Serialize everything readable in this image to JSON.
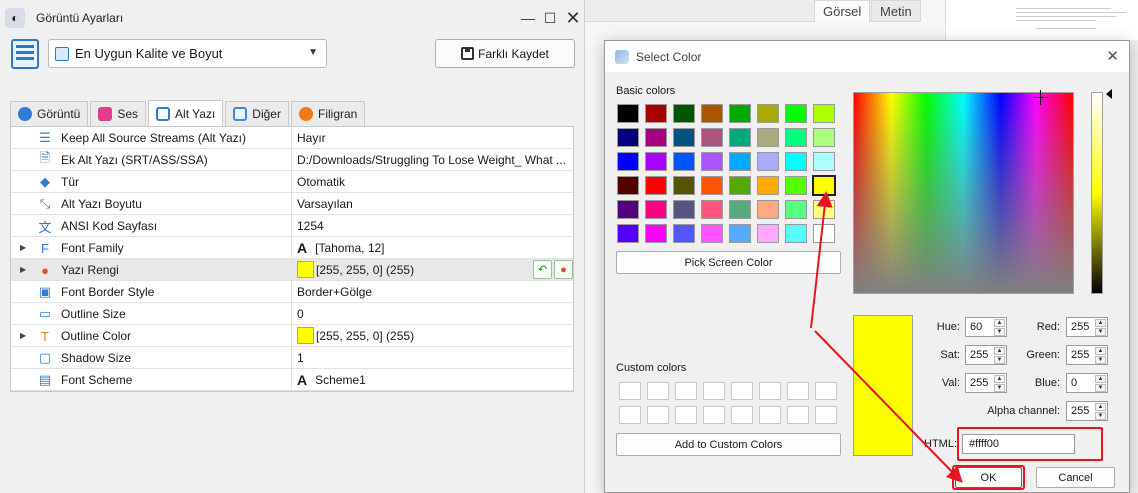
{
  "background": {
    "tabs": [
      "Görsel",
      "Metin"
    ],
    "fragments": [
      "ek",
      "la"
    ]
  },
  "main_window": {
    "title": "Görüntü Ayarları",
    "preset": "En Uygun Kalite ve Boyut",
    "save_as": "Farklı Kaydet",
    "tabs": [
      {
        "label": "Görüntü",
        "icon": "monitor-icon",
        "color": "#2f7cd3"
      },
      {
        "label": "Ses",
        "icon": "music-icon",
        "color": "#e23d8c"
      },
      {
        "label": "Alt Yazı",
        "icon": "subtitle-icon",
        "color": "#2f7cd3"
      },
      {
        "label": "Diğer",
        "icon": "sliders-icon",
        "color": "#3a8bd8"
      },
      {
        "label": "Filigran",
        "icon": "watermark-icon",
        "color": "#f07a1a"
      }
    ],
    "properties": [
      {
        "name": "Keep All Source Streams (Alt Yazı)",
        "value": "Hayır",
        "icon": "streams-icon",
        "glyph": "☰",
        "expandable": false
      },
      {
        "name": "Ek Alt Yazı (SRT/ASS/SSA)",
        "value": "D:/Downloads/Struggling To Lose Weight_ What ...",
        "icon": "file-icon",
        "glyph": "🗎",
        "expandable": false
      },
      {
        "name": "Tür",
        "value": "Otomatik",
        "icon": "cube-icon",
        "glyph": "◆",
        "expandable": false
      },
      {
        "name": "Alt Yazı Boyutu",
        "value": "Varsayılan",
        "icon": "resize-icon",
        "glyph": "⤡",
        "expandable": false
      },
      {
        "name": "ANSI Kod Sayfası",
        "value": "1254",
        "icon": "translate-icon",
        "glyph": "文",
        "expandable": false
      },
      {
        "name": "Font Family",
        "value": "[Tahoma, 12]",
        "icon": "font-icon",
        "glyph": "F",
        "prefix_glyph": "A",
        "expandable": true
      },
      {
        "name": "Yazı Rengi",
        "value": "[255, 255, 0] (255)",
        "icon": "palette-icon",
        "glyph": "●",
        "swatch": "#ffff00",
        "expandable": true,
        "selected": true
      },
      {
        "name": "Font Border Style",
        "value": "Border+Gölge",
        "icon": "image-icon",
        "glyph": "▣",
        "expandable": false
      },
      {
        "name": "Outline Size",
        "value": "0",
        "icon": "outline-size-icon",
        "glyph": "▭",
        "expandable": false
      },
      {
        "name": "Outline Color",
        "value": "[255, 255, 0] (255)",
        "icon": "outline-color-icon",
        "glyph": "T",
        "swatch": "#ffff00",
        "expandable": true
      },
      {
        "name": "Shadow Size",
        "value": "1",
        "icon": "shadow-icon",
        "glyph": "▢",
        "expandable": false
      },
      {
        "name": "Font Scheme",
        "value": "Scheme1",
        "icon": "scheme-icon",
        "glyph": "▤",
        "prefix_glyph": "A",
        "expandable": false
      }
    ]
  },
  "color_dialog": {
    "title": "Select Color",
    "basic_colors_label": "Basic colors",
    "basic_colors": [
      "#000000",
      "#aa0000",
      "#005500",
      "#aa5500",
      "#00aa00",
      "#aaaa00",
      "#00ff00",
      "#aaff00",
      "#00007f",
      "#aa007f",
      "#00557f",
      "#aa557f",
      "#00aa7f",
      "#aaaa7f",
      "#00ff7f",
      "#aaff7f",
      "#0000ff",
      "#aa00ff",
      "#0055ff",
      "#aa55ff",
      "#00aaff",
      "#aaaaff",
      "#00ffff",
      "#aaffff",
      "#550000",
      "#ff0000",
      "#555500",
      "#ff5500",
      "#55aa00",
      "#ffaa00",
      "#55ff00",
      "#ffff00",
      "#55007f",
      "#ff007f",
      "#55557f",
      "#ff557f",
      "#55aa7f",
      "#ffaa7f",
      "#55ff7f",
      "#ffff7f",
      "#5500ff",
      "#ff00ff",
      "#5555ff",
      "#ff55ff",
      "#55aaff",
      "#ffaaff",
      "#55ffff",
      "#ffffff"
    ],
    "selected_basic_index": 31,
    "pick_screen_color": "Pick Screen Color",
    "custom_colors_label": "Custom colors",
    "add_custom": "Add to Custom Colors",
    "fields": {
      "hue": {
        "label": "Hue:",
        "value": "60"
      },
      "sat": {
        "label": "Sat:",
        "value": "255"
      },
      "val": {
        "label": "Val:",
        "value": "255"
      },
      "red": {
        "label": "Red:",
        "value": "255"
      },
      "green": {
        "label": "Green:",
        "value": "255"
      },
      "blue": {
        "label": "Blue:",
        "value": "0"
      },
      "alpha": {
        "label": "Alpha channel:",
        "value": "255"
      }
    },
    "html_label": "HTML:",
    "html_value": "#ffff00",
    "ok": "OK",
    "cancel": "Cancel",
    "current_color": "#ffff00"
  },
  "annotation_color": "#e8141e"
}
